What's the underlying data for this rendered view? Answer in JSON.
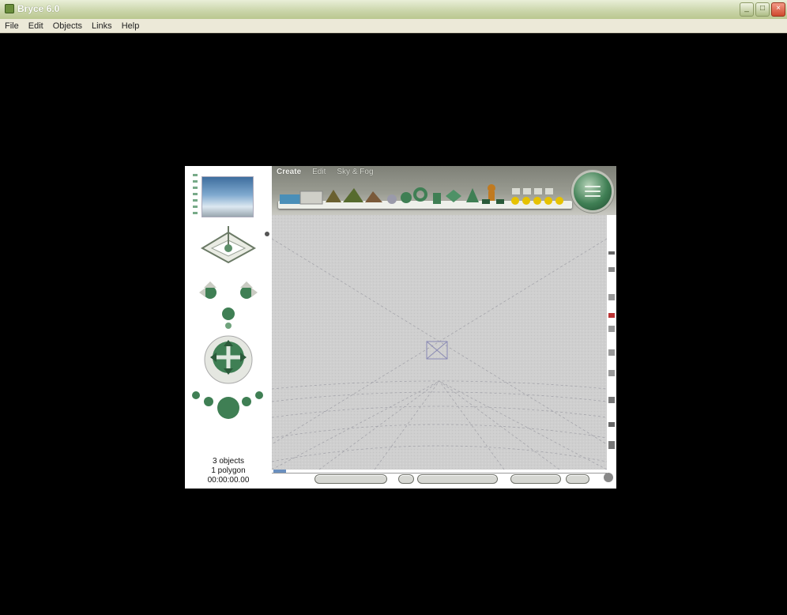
{
  "window": {
    "title": "Bryce 6.0",
    "menus": [
      "File",
      "Edit",
      "Objects",
      "Links",
      "Help"
    ],
    "controls": {
      "minimize": "_",
      "maximize": "□",
      "close": "×"
    }
  },
  "app": {
    "tabs": [
      "Create",
      "Edit",
      "Sky & Fog"
    ],
    "active_tab": "Create",
    "status": {
      "objects": "3 objects",
      "polygons": "1 polygon",
      "time": "00:00:00.00"
    }
  },
  "colors": {
    "accent_green": "#3f7f54",
    "viewport_bg": "#cfcfcf",
    "grid_line": "#8f8f96",
    "camera_wire": "#8a8ab4"
  },
  "icons": {
    "primitives": [
      "terrain",
      "water-plane",
      "infinite-plane",
      "tree",
      "stone",
      "sphere",
      "torus",
      "cylinder",
      "cube",
      "cone",
      "figure",
      "lights"
    ]
  }
}
